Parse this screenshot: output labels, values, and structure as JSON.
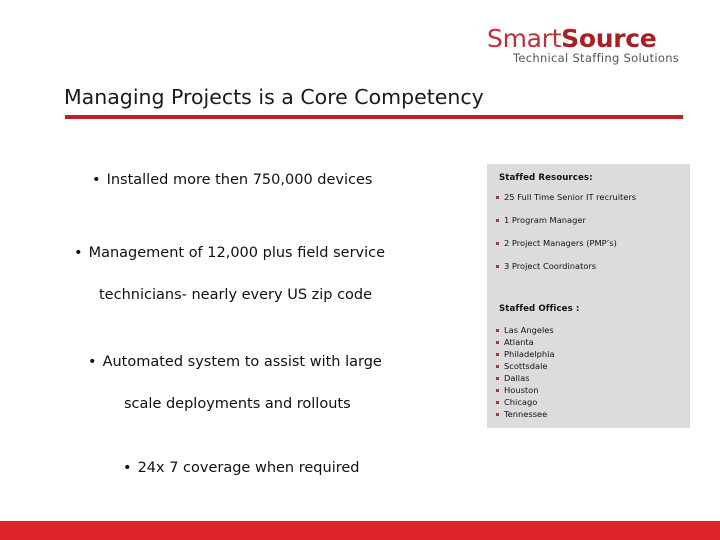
{
  "logo": {
    "name_part1": "Smart",
    "name_part2": "Source",
    "tagline": "Technical Staffing Solutions",
    "brand_red": "#C0303A",
    "brand_dark_red": "#A81F28"
  },
  "slide": {
    "title": "Managing Projects is a Core Competency",
    "rule_color": "#BE1E2D",
    "footer_color": "#DD2229",
    "panel_bg": "#DCDCDC"
  },
  "bullets": [
    {
      "marker": "•",
      "lines": [
        "Installed more then 750,000 devices"
      ]
    },
    {
      "marker": "•",
      "lines": [
        "Management of 12,000 plus field service",
        "technicians- nearly every US zip code"
      ]
    },
    {
      "marker": "•",
      "lines": [
        "Automated system to assist with large",
        "scale deployments and rollouts"
      ]
    },
    {
      "marker": "•",
      "lines": [
        "24x 7 coverage when required"
      ]
    }
  ],
  "panel": {
    "resources_heading": "Staffed Resources:",
    "resources": [
      "25 Full Time Senior IT recruiters",
      "1 Program Manager",
      "2 Project Managers (PMP’s)",
      "3 Project Coordinators"
    ],
    "offices_heading": "Staffed Offices :",
    "offices": [
      "Las Angeles",
      "Atlanta",
      "Philadelphia",
      "Scottsdale",
      "Dallas",
      "Houston",
      "Chicago",
      "Tennessee"
    ]
  }
}
